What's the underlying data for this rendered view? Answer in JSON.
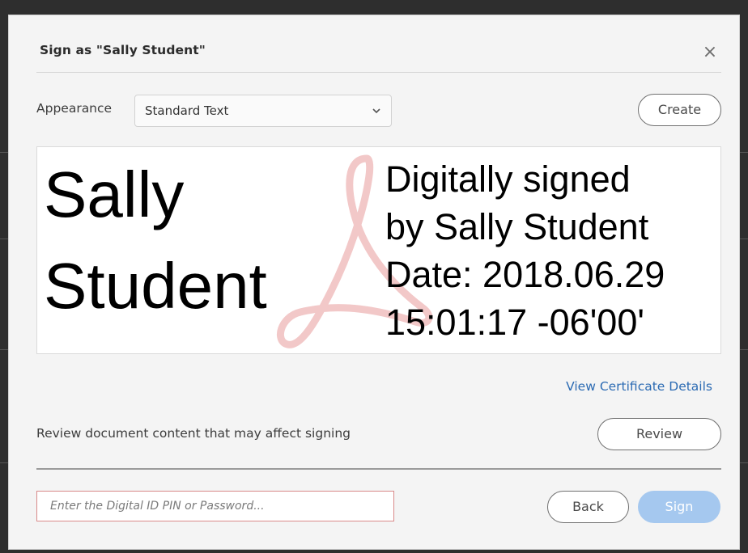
{
  "dialog": {
    "title": "Sign as \"Sally Student\"",
    "close_icon": "close-icon"
  },
  "appearance": {
    "label": "Appearance",
    "selected": "Standard Text",
    "create_label": "Create"
  },
  "preview": {
    "name_lines": [
      "Sally",
      "Student"
    ],
    "detail_lines": [
      "Digitally signed",
      "by Sally Student",
      "Date: 2018.06.29",
      "15:01:17 -06'00'"
    ],
    "watermark_icon": "acrobat-logo-watermark",
    "watermark_color": "#f2c8c8"
  },
  "certificate": {
    "link_label": "View Certificate Details"
  },
  "review": {
    "text": "Review document content that may affect signing",
    "button_label": "Review"
  },
  "footer": {
    "pin_placeholder": "Enter the Digital ID PIN or Password...",
    "pin_value": "",
    "back_label": "Back",
    "sign_label": "Sign"
  },
  "colors": {
    "link": "#2c6bb3",
    "sign_button_disabled": "#a5c8ef",
    "pin_border_error": "#d98a8a"
  }
}
